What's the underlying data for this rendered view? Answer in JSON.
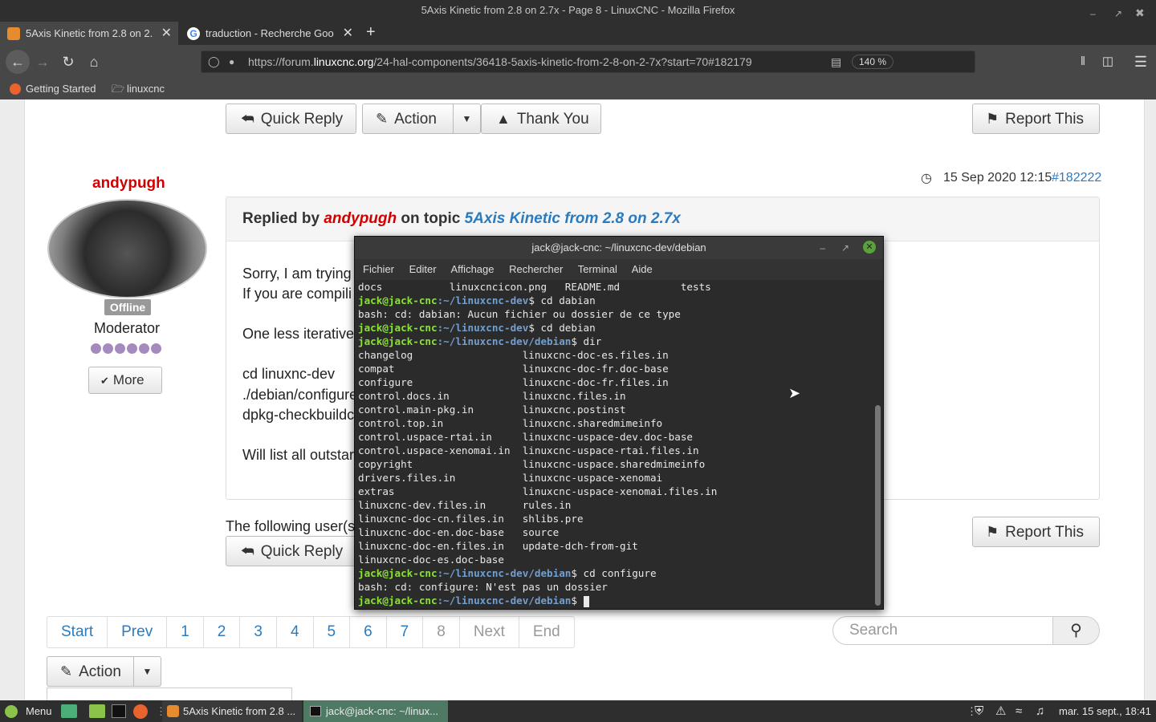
{
  "window": {
    "title": "5Axis Kinetic from 2.8 on 2.7x - Page 8 - LinuxCNC - Mozilla Firefox"
  },
  "tabs": [
    {
      "label": "5Axis Kinetic from 2.8 on 2.",
      "favicon_color": "#e88a2e"
    },
    {
      "label": "traduction - Recherche Goo",
      "favicon_color": "#ffffff"
    }
  ],
  "url": {
    "prefix": "https://forum.",
    "domain": "linuxcnc.org",
    "suffix": "/24-hal-components/36418-5axis-kinetic-from-2-8-on-2-7x?start=70#182179",
    "zoom": "140 %"
  },
  "bookmarks": [
    {
      "label": "Getting Started"
    },
    {
      "label": "linuxcnc"
    }
  ],
  "post_actions": {
    "quick_reply": "Quick Reply",
    "action": "Action",
    "thank_you": "Thank You",
    "report": "Report This"
  },
  "post": {
    "author": "andypugh",
    "status": "Offline",
    "rank": "Moderator",
    "more": "More",
    "timestamp": "15 Sep 2020 12:15",
    "post_id": "#182222",
    "replied_by": "Replied by",
    "on_topic": "on topic",
    "topic": "5Axis Kinetic from 2.8 on 2.7x",
    "lines": [
      "Sorry, I am trying",
      "If you are compili",
      "One less iterative",
      "cd linuxnc-dev",
      "./debian/configure",
      "dpkg-checkbuildc",
      "Will list all outstar"
    ],
    "thanks_prefix": "The following user(s"
  },
  "pagination": {
    "start": "Start",
    "prev": "Prev",
    "pages": [
      "1",
      "2",
      "3",
      "4",
      "5",
      "6",
      "7",
      "8"
    ],
    "current": "8",
    "next": "Next",
    "end": "End"
  },
  "search": {
    "placeholder": "Search"
  },
  "bottom_action": "Action",
  "terminal": {
    "title": "jack@jack-cnc: ~/linuxcnc-dev/debian",
    "menu": [
      "Fichier",
      "Editer",
      "Affichage",
      "Rechercher",
      "Terminal",
      "Aide"
    ],
    "lines": [
      {
        "t": "docs           linuxcncicon.png   README.md          tests"
      },
      {
        "p": "jack@jack-cnc",
        "d": ":~/linuxcnc-dev",
        "c": "$ cd dabian"
      },
      {
        "t": "bash: cd: dabian: Aucun fichier ou dossier de ce type"
      },
      {
        "p": "jack@jack-cnc",
        "d": ":~/linuxcnc-dev",
        "c": "$ cd debian"
      },
      {
        "p": "jack@jack-cnc",
        "d": ":~/linuxcnc-dev/debian",
        "c": "$ dir"
      },
      {
        "t": "changelog                  linuxcnc-doc-es.files.in"
      },
      {
        "t": "compat                     linuxcnc-doc-fr.doc-base"
      },
      {
        "t": "configure                  linuxcnc-doc-fr.files.in"
      },
      {
        "t": "control.docs.in            linuxcnc.files.in"
      },
      {
        "t": "control.main-pkg.in        linuxcnc.postinst"
      },
      {
        "t": "control.top.in             linuxcnc.sharedmimeinfo"
      },
      {
        "t": "control.uspace-rtai.in     linuxcnc-uspace-dev.doc-base"
      },
      {
        "t": "control.uspace-xenomai.in  linuxcnc-uspace-rtai.files.in"
      },
      {
        "t": "copyright                  linuxcnc-uspace.sharedmimeinfo"
      },
      {
        "t": "drivers.files.in           linuxcnc-uspace-xenomai"
      },
      {
        "t": "extras                     linuxcnc-uspace-xenomai.files.in"
      },
      {
        "t": "linuxcnc-dev.files.in      rules.in"
      },
      {
        "t": "linuxcnc-doc-cn.files.in   shlibs.pre"
      },
      {
        "t": "linuxcnc-doc-en.doc-base   source"
      },
      {
        "t": "linuxcnc-doc-en.files.in   update-dch-from-git"
      },
      {
        "t": "linuxcnc-doc-es.doc-base"
      },
      {
        "p": "jack@jack-cnc",
        "d": ":~/linuxcnc-dev/debian",
        "c": "$ cd configure"
      },
      {
        "t": "bash: cd: configure: N'est pas un dossier"
      },
      {
        "p": "jack@jack-cnc",
        "d": ":~/linuxcnc-dev/debian",
        "c": "$ "
      }
    ]
  },
  "taskbar": {
    "menu": "Menu",
    "items": [
      "5Axis Kinetic from 2.8 ...",
      "jack@jack-cnc: ~/linux..."
    ],
    "clock": "mar. 15 sept., 18:41"
  }
}
